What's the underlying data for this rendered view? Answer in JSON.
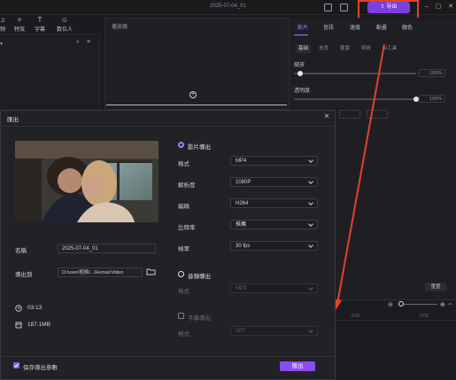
{
  "app": {
    "doc_title": "2025-07-04_01",
    "export_button": "导出"
  },
  "left_toolbar": [
    {
      "icon": "audio-icon",
      "label": "频"
    },
    {
      "icon": "effects-icon",
      "label": "特效"
    },
    {
      "icon": "subtitle-icon",
      "label": "字幕"
    },
    {
      "icon": "digital-human-icon",
      "label": "数位人"
    }
  ],
  "player": {
    "title": "播放器"
  },
  "properties": {
    "tabs": [
      "影片",
      "音訊",
      "速度",
      "動畫",
      "顏色"
    ],
    "active_tab": "影片",
    "subtabs": [
      "基础",
      "去背",
      "蒙版",
      "特效",
      "AI工具"
    ],
    "active_subtab": "基础",
    "scale_label": "縮放",
    "scale_value": "100%",
    "scale_level": 0.05,
    "opacity_label": "透明度",
    "opacity_value": "100%",
    "opacity_level": 1.0,
    "reset": "重置"
  },
  "timeline": {
    "ruler": [
      "0:00",
      "0:05"
    ]
  },
  "modal": {
    "title": "匯出",
    "name_label": "名稱",
    "name_value": "2025-07-04_01",
    "path_label": "導出到",
    "path_value": "D:/user/视频/...lHumanVideo",
    "duration": "03:13",
    "size": "187.1MB",
    "video_section": "影片導出",
    "video_options": [
      {
        "label": "格式",
        "value": "MP4"
      },
      {
        "label": "解析度",
        "value": "1080P"
      },
      {
        "label": "編碼",
        "value": "H264"
      },
      {
        "label": "比特率",
        "value": "推薦"
      },
      {
        "label": "幀率",
        "value": "30  fps"
      }
    ],
    "audio_section": "音頻導出",
    "audio_format_label": "格式",
    "audio_format_value": "MP3",
    "subtitle_section": "字幕導出",
    "subtitle_format_label": "格式",
    "subtitle_format_value": "SRT",
    "save_params": "保存導出參數",
    "export_button": "匯出"
  },
  "colors": {
    "accent": "#8a4df2",
    "annotation_red": "#e0432c"
  }
}
